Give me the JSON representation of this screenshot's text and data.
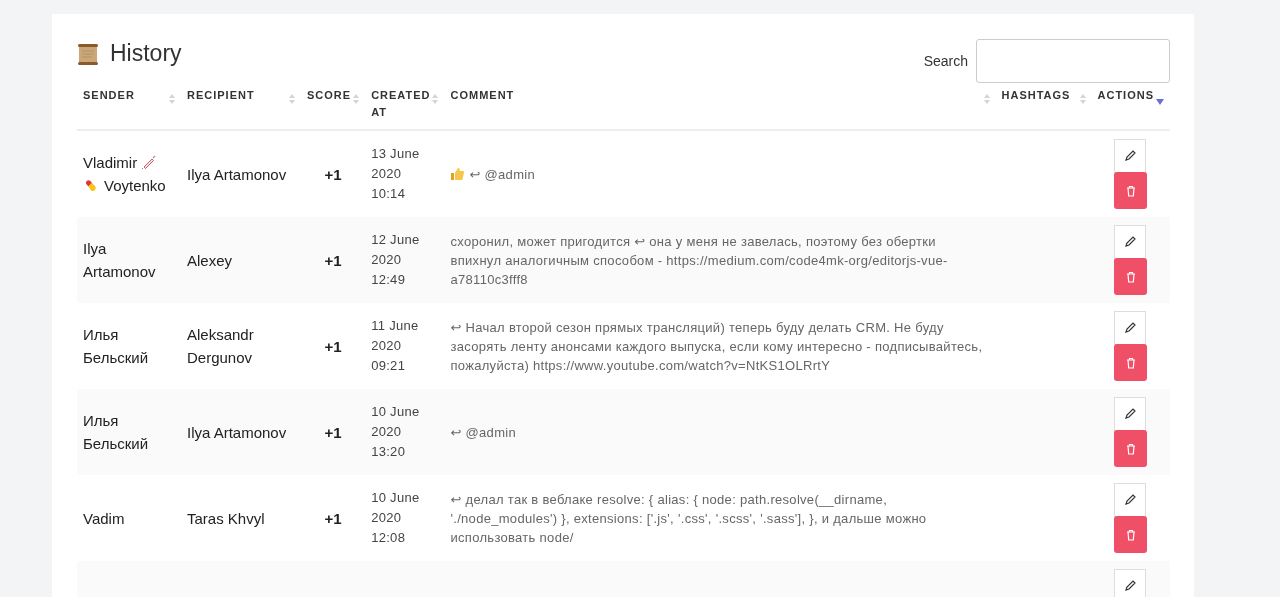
{
  "title": "History",
  "search": {
    "label": "Search"
  },
  "table": {
    "columns": [
      {
        "label": "SENDER",
        "sorted": false
      },
      {
        "label": "RECIPIENT",
        "sorted": false
      },
      {
        "label": "SCORE",
        "sorted": false
      },
      {
        "label": "CREATED AT",
        "sorted": false
      },
      {
        "label": "COMMENT",
        "sorted": false
      },
      {
        "label": "HASHTAGS",
        "sorted": false
      },
      {
        "label": "ACTIONS",
        "sorted": true
      }
    ],
    "rows": [
      {
        "sender": [
          {
            "kind": "text",
            "text": "Vladimir"
          },
          {
            "kind": "syringe"
          },
          {
            "kind": "pill"
          },
          {
            "kind": "text",
            "text": "Voytenko"
          }
        ],
        "recipient": "Ilya Artamonov",
        "score": "+1",
        "created": [
          "13 June",
          "2020",
          "10:14"
        ],
        "comment_icons": [
          {
            "kind": "thumbs-up"
          }
        ],
        "comment": "↩ @admin"
      },
      {
        "sender": [
          {
            "kind": "text",
            "text": "Ilya Artamonov"
          }
        ],
        "recipient": "Alexey",
        "score": "+1",
        "created": [
          "12 June",
          "2020",
          "12:49"
        ],
        "comment": "схоронил, может пригодится ↩ она у меня не завелась, поэтому без обертки впихнул аналогичным способом - https://medium.com/code4mk-org/editorjs-vue-a78110c3fff8"
      },
      {
        "sender": [
          {
            "kind": "text",
            "text": "Илья Бельский"
          }
        ],
        "recipient": "Aleksandr Dergunov",
        "score": "+1",
        "created": [
          "11 June",
          "2020",
          "09:21"
        ],
        "comment": "↩ Начал второй сезон прямых трансляций) теперь буду делать CRM. Не буду засорять ленту анонсами каждого выпуска, если кому интересно - подписывайтесь, пожалуйста) https://www.youtube.com/watch?v=NtKS1OLRrtY"
      },
      {
        "sender": [
          {
            "kind": "text",
            "text": "Илья Бельский"
          }
        ],
        "recipient": "Ilya Artamonov",
        "score": "+1",
        "created": [
          "10 June",
          "2020",
          "13:20"
        ],
        "comment": "↩ @admin"
      },
      {
        "sender": [
          {
            "kind": "text",
            "text": "Vadim"
          }
        ],
        "recipient": "Taras Khvyl",
        "score": "+1",
        "created": [
          "10 June",
          "2020",
          "12:08"
        ],
        "comment": "↩ делал так в веблаке resolve: { alias: { node: path.resolve(__dirname, './node_modules') }, extensions: ['.js', '.css', '.scss', '.sass'], }, и дальше можно использовать node/"
      },
      {}
    ]
  }
}
